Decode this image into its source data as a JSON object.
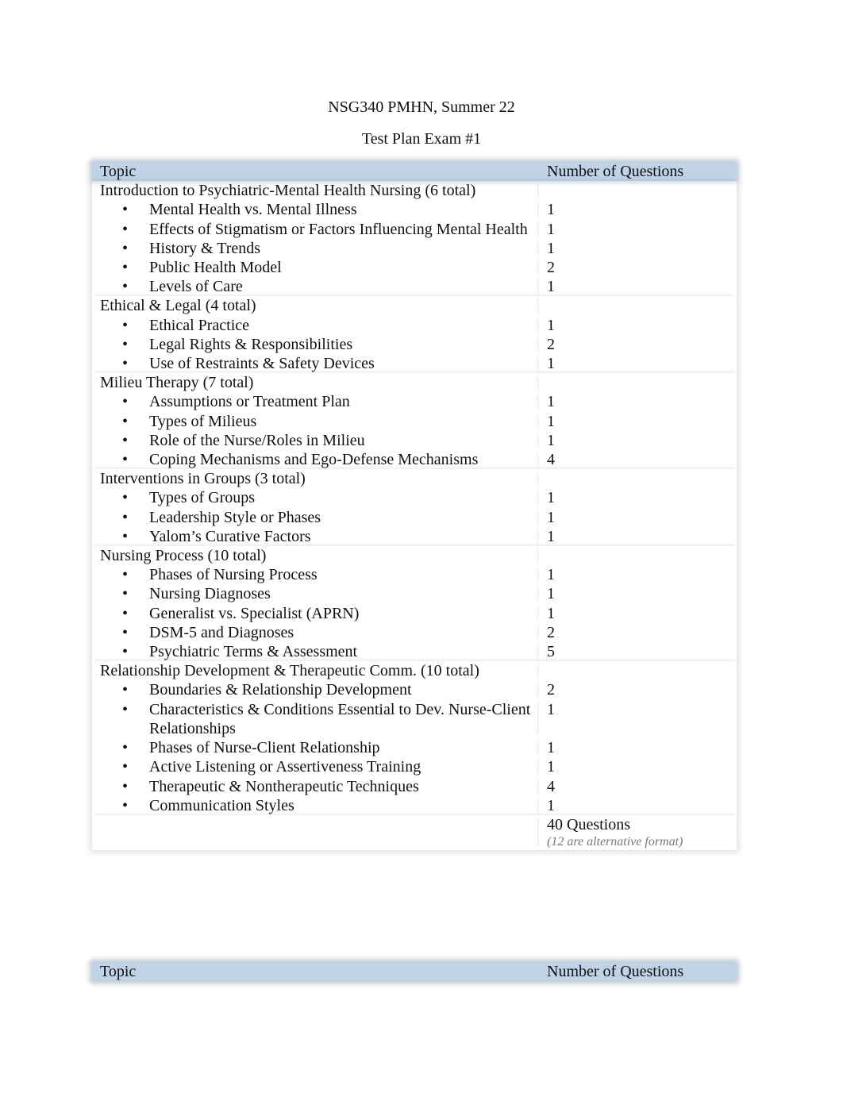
{
  "document": {
    "title": "NSG340 PMHN, Summer 22",
    "subtitle": "Test Plan Exam #1"
  },
  "table": {
    "headers": {
      "topic": "Topic",
      "count": "Number of Questions"
    },
    "sections": [
      {
        "title": "Introduction to Psychiatric-Mental Health Nursing (6 total)",
        "items": [
          {
            "topic": "Mental Health vs. Mental Illness",
            "count": "1"
          },
          {
            "topic": "Effects of Stigmatism or Factors Influencing Mental Health",
            "count": "1"
          },
          {
            "topic": "History & Trends",
            "count": "1"
          },
          {
            "topic": "Public Health Model",
            "count": "2"
          },
          {
            "topic": "Levels of Care",
            "count": "1"
          }
        ]
      },
      {
        "title": "Ethical & Legal (4 total)",
        "items": [
          {
            "topic": "Ethical Practice",
            "count": "1"
          },
          {
            "topic": "Legal Rights & Responsibilities",
            "count": "2"
          },
          {
            "topic": "Use of Restraints & Safety Devices",
            "count": "1"
          }
        ]
      },
      {
        "title": "Milieu Therapy (7 total)",
        "items": [
          {
            "topic": "Assumptions or Treatment Plan",
            "count": "1"
          },
          {
            "topic": "Types of Milieus",
            "count": "1"
          },
          {
            "topic": "Role of the Nurse/Roles in Milieu",
            "count": "1"
          },
          {
            "topic": "Coping Mechanisms and Ego-Defense Mechanisms",
            "count": "4"
          }
        ]
      },
      {
        "title": "Interventions in Groups (3 total)",
        "items": [
          {
            "topic": "Types of Groups",
            "count": "1"
          },
          {
            "topic": "Leadership Style or Phases",
            "count": "1"
          },
          {
            "topic": "Yalom’s Curative Factors",
            "count": "1"
          }
        ]
      },
      {
        "title": "Nursing Process (10 total)",
        "items": [
          {
            "topic": "Phases of Nursing Process",
            "count": "1"
          },
          {
            "topic": "Nursing Diagnoses",
            "count": "1"
          },
          {
            "topic": "Generalist vs. Specialist (APRN)",
            "count": "1"
          },
          {
            "topic": "DSM-5 and Diagnoses",
            "count": "2"
          },
          {
            "topic": "Psychiatric Terms & Assessment",
            "count": "5"
          }
        ]
      },
      {
        "title": "Relationship Development & Therapeutic Comm. (10 total)",
        "items": [
          {
            "topic": "Boundaries & Relationship Development",
            "count": "2"
          },
          {
            "topic": "Characteristics & Conditions Essential to Dev. Nurse-Client Relationships",
            "count": "1"
          },
          {
            "topic": "Phases of Nurse-Client Relationship",
            "count": "1"
          },
          {
            "topic": "Active Listening or Assertiveness Training",
            "count": "1"
          },
          {
            "topic": "Therapeutic & Nontherapeutic Techniques",
            "count": "4"
          },
          {
            "topic": "Communication Styles",
            "count": "1"
          }
        ]
      }
    ],
    "total": {
      "label": "40 Questions",
      "note": "(12 are alternative format)"
    }
  },
  "table2": {
    "headers": {
      "topic": "Topic",
      "count": "Number of Questions"
    }
  }
}
